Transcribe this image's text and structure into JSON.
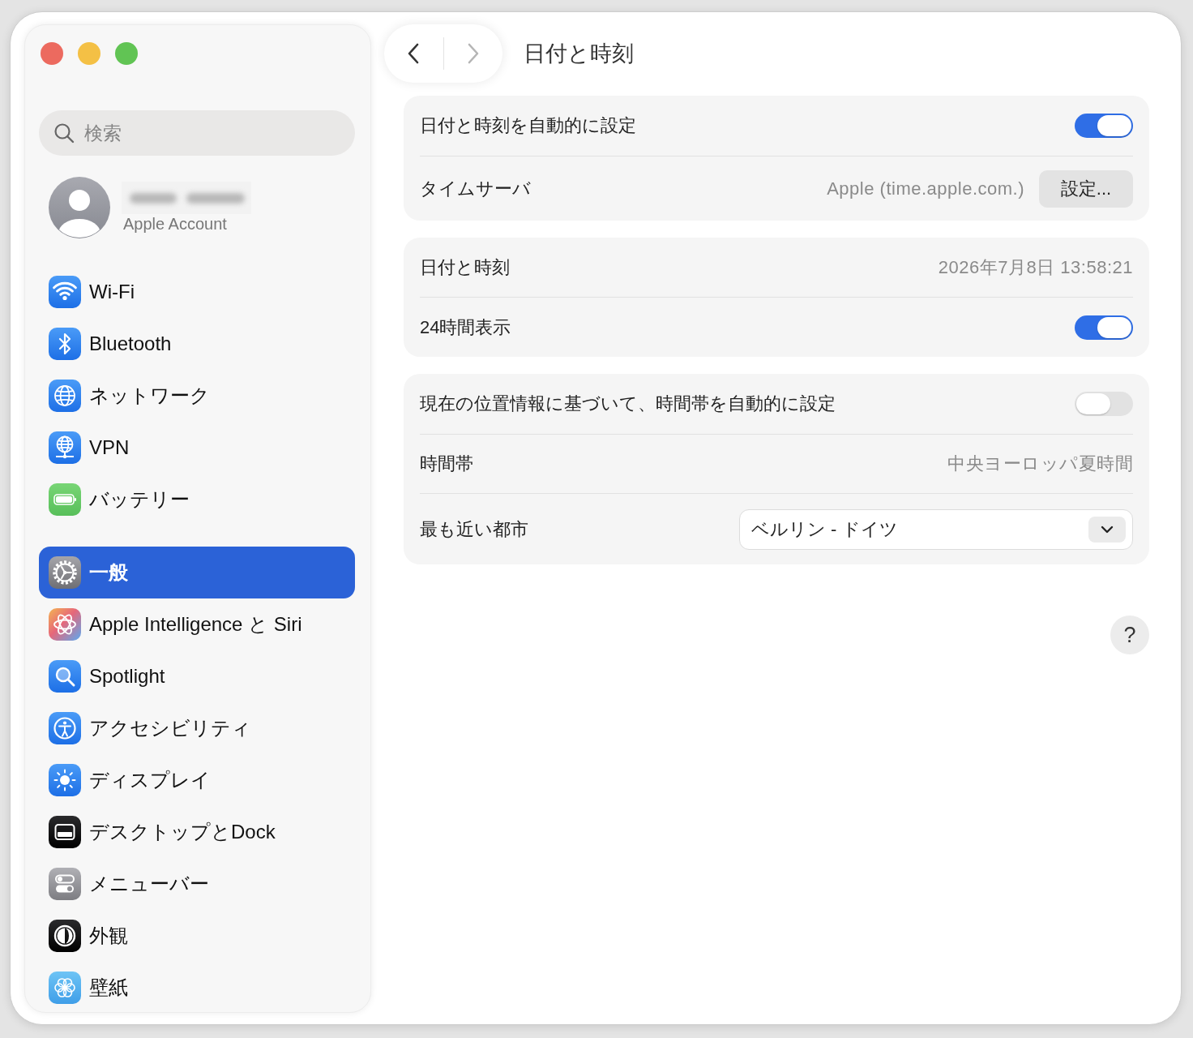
{
  "toolbar": {
    "back": {
      "disabled": false
    },
    "forward": {
      "disabled": true
    },
    "title": "日付と時刻"
  },
  "sidebar": {
    "search": {
      "placeholder": "検索"
    },
    "account": {
      "subtitle": "Apple Account"
    },
    "sections": [
      {
        "items": [
          {
            "label": "Wi-Fi",
            "selected": false
          },
          {
            "label": "Bluetooth",
            "selected": false
          },
          {
            "label": "ネットワーク",
            "selected": false
          },
          {
            "label": "VPN",
            "selected": false
          },
          {
            "label": "バッテリー",
            "selected": false
          }
        ]
      },
      {
        "items": [
          {
            "label": "一般",
            "selected": true
          },
          {
            "label": "Apple Intelligence と Siri",
            "selected": false
          },
          {
            "label": "Spotlight",
            "selected": false
          },
          {
            "label": "アクセシビリティ",
            "selected": false
          },
          {
            "label": "ディスプレイ",
            "selected": false
          },
          {
            "label": "デスクトップとDock",
            "selected": false
          },
          {
            "label": "メニューバー",
            "selected": false
          },
          {
            "label": "外観",
            "selected": false
          },
          {
            "label": "壁紙",
            "selected": false
          }
        ]
      }
    ]
  },
  "groups": [
    {
      "rows": [
        {
          "kind": "toggle",
          "label": "日付と時刻を自動的に設定",
          "on": true
        },
        {
          "kind": "value_button",
          "label": "タイムサーバ",
          "value": "Apple (time.apple.com.)",
          "button": "設定..."
        }
      ]
    },
    {
      "rows": [
        {
          "kind": "value",
          "label": "日付と時刻",
          "value": "2026年7月8日 13:58:21"
        },
        {
          "kind": "toggle",
          "label": "24時間表示",
          "on": true
        }
      ]
    },
    {
      "rows": [
        {
          "kind": "toggle",
          "label": "現在の位置情報に基づいて、時間帯を自動的に設定",
          "on": false
        },
        {
          "kind": "value",
          "label": "時間帯",
          "value": "中央ヨーロッパ夏時間"
        },
        {
          "kind": "dropdown",
          "label": "最も近い都市",
          "value": "ベルリン - ドイツ"
        }
      ]
    }
  ],
  "help": {
    "label": "?"
  }
}
